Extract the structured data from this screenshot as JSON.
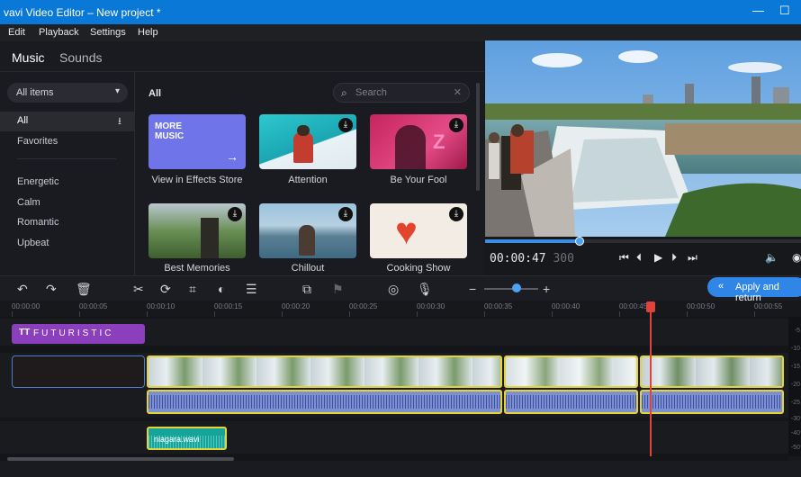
{
  "window": {
    "title": "vavi Video Editor – New project *",
    "minimize": "—",
    "maximize": "☐"
  },
  "menu": [
    "Edit",
    "Playback",
    "Settings",
    "Help"
  ],
  "library": {
    "tabs": [
      "Music",
      "Sounds"
    ],
    "filter_label": "All items",
    "categories": [
      "All",
      "Favorites",
      "Energetic",
      "Calm",
      "Romantic",
      "Upbeat"
    ],
    "grid_header": "All",
    "search_placeholder": "Search",
    "promo_text": "MORE\nMUSIC",
    "tiles": [
      "View in Effects Store",
      "Attention",
      "Be Your Fool",
      "Best Memories",
      "Chillout",
      "Cooking Show"
    ]
  },
  "player": {
    "time_main": "00:00:47",
    "time_ms": "300",
    "progress_fraction": 0.3
  },
  "toolbar": {
    "apply_label": "Apply and return"
  },
  "ruler": [
    "00:00:00",
    "00:00:05",
    "00:00:10",
    "00:00:15",
    "00:00:20",
    "00:00:25",
    "00:00:30",
    "00:00:35",
    "00:00:40",
    "00:00:45",
    "00:00:50",
    "00:00:55"
  ],
  "timeline": {
    "title_clip": "FUTURISTIC",
    "title_icon": "TT",
    "music_clip": "niagara.wavi"
  },
  "vu_scale": [
    "-5",
    "-10",
    "-15",
    "-20",
    "-25",
    "-30",
    "-40",
    "-50"
  ],
  "colors": {
    "accent": "#2f86e6",
    "title_clip": "#8b3fbc",
    "music_clip": "#16a39a",
    "playhead": "#e0433b",
    "selection": "#e3d43b"
  }
}
